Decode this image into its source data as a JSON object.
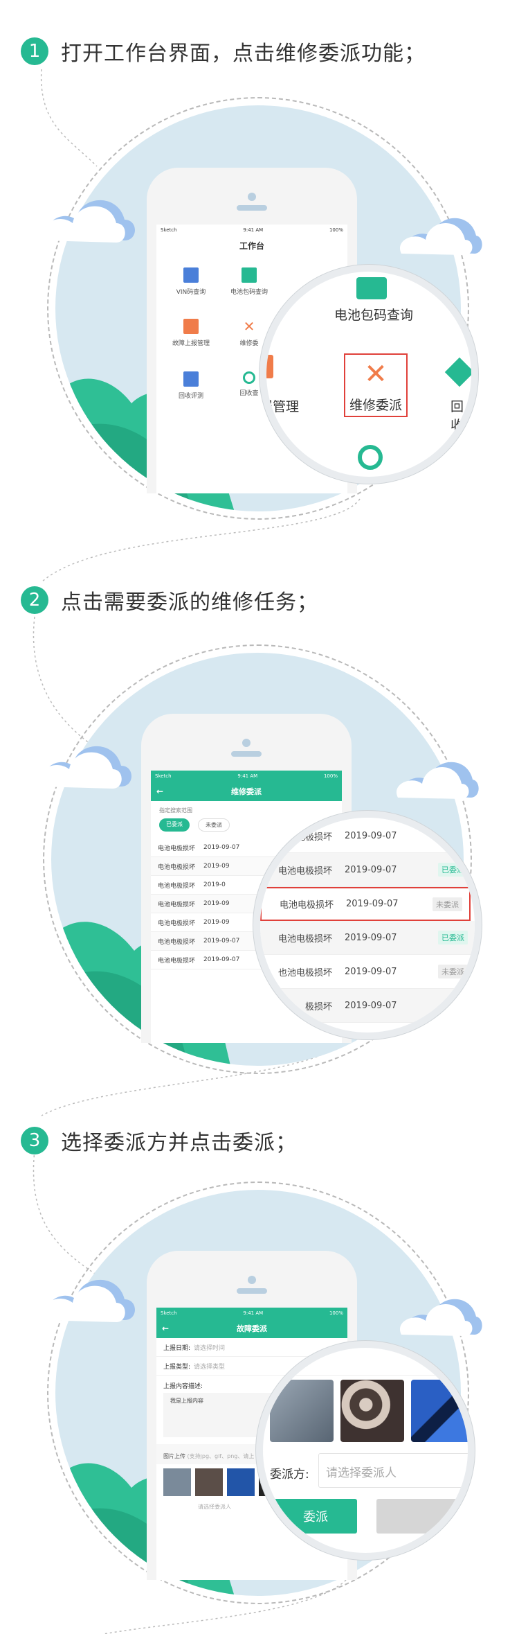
{
  "steps": [
    {
      "number": "1",
      "text": "打开工作台界面，点击维修委派功能；"
    },
    {
      "number": "2",
      "text": "点击需要委派的维修任务；"
    },
    {
      "number": "3",
      "text": "选择委派方并点击委派；"
    }
  ],
  "status_bar": {
    "carrier": "Sketch",
    "time": "9:41 AM",
    "battery": "100%"
  },
  "step1": {
    "screen_title": "工作台",
    "grid": [
      {
        "label": "VIN码查询",
        "icon": "vin-icon"
      },
      {
        "label": "电池包码查询",
        "icon": "battery-icon"
      },
      {
        "label": "故障上报管理",
        "icon": "upload-icon"
      },
      {
        "label": "维修委",
        "icon": "wrench-icon"
      },
      {
        "label": "回收评测",
        "icon": "list-icon"
      },
      {
        "label": "回收查",
        "icon": "search-icon"
      }
    ],
    "zoom": {
      "battery_label": "电池包码查询",
      "fault_label_partial": "报管理",
      "repair_label": "维修委派",
      "recycle_label_partial": "回收"
    }
  },
  "step2": {
    "screen_title": "维修委派",
    "filter_label": "指定搜索范围",
    "filter_assigned": "已委派",
    "filter_unassigned": "未委派",
    "rows": [
      {
        "name": "电池电极损坏",
        "date": "2019-09-07"
      },
      {
        "name": "电池电极损坏",
        "date": "2019-09"
      },
      {
        "name": "电池电极损坏",
        "date": "2019-0"
      },
      {
        "name": "电池电极损坏",
        "date": "2019-09"
      },
      {
        "name": "电池电极损坏",
        "date": "2019-09"
      },
      {
        "name": "电池电极损坏",
        "date": "2019-09-07"
      },
      {
        "name": "电池电极损坏",
        "date": "2019-09-07",
        "status": "未委派"
      }
    ],
    "zoom_rows": [
      {
        "name": "电极损坏",
        "date": "2019-09-07",
        "status": ""
      },
      {
        "name": "电池电极损坏",
        "date": "2019-09-07",
        "status": "已委派"
      },
      {
        "name": "电池电极损坏",
        "date": "2019-09-07",
        "status": "未委派"
      },
      {
        "name": "电池电极损坏",
        "date": "2019-09-07",
        "status": "已委派"
      },
      {
        "name": "也池电极损坏",
        "date": "2019-09-07",
        "status": "未委派"
      },
      {
        "name": "极损坏",
        "date": "2019-09-07",
        "status": ""
      }
    ]
  },
  "step3": {
    "screen_title": "故障委派",
    "date_label": "上报日期:",
    "date_placeholder": "请选择时间",
    "type_label": "上报类型:",
    "type_placeholder": "请选择类型",
    "desc_label": "上报内容描述:",
    "desc_value": "我是上报内容",
    "upload_label": "图片上传",
    "upload_hint": "(支持jpg、gif、png、请上",
    "assignee_placeholder_small": "请选择委派人",
    "zoom": {
      "assign_label": "委派方:",
      "assign_placeholder": "请选择委派人",
      "assign_button": "委派"
    }
  },
  "colors": {
    "brand": "#26b992",
    "sky": "#d7e8f1",
    "highlight": "#e0403a"
  }
}
